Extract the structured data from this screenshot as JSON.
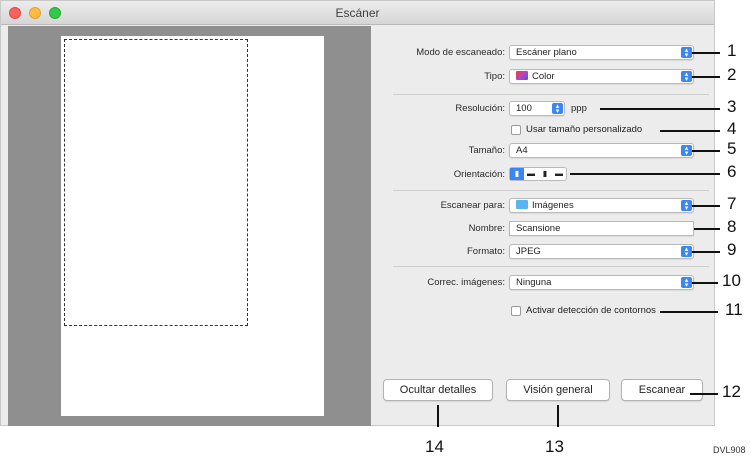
{
  "window": {
    "title": "Escáner"
  },
  "form": {
    "mode_label": "Modo de escaneado:",
    "mode_value": "Escáner plano",
    "type_label": "Tipo:",
    "type_value": "Color",
    "res_label": "Resolución:",
    "res_value": "100",
    "res_unit": "ppp",
    "custom_size_label": "Usar tamaño personalizado",
    "size_label": "Tamaño:",
    "size_value": "A4",
    "orient_label": "Orientación:",
    "scan_to_label": "Escanear para:",
    "scan_to_value": "Imágenes",
    "name_label": "Nombre:",
    "name_value": "Scansione",
    "format_label": "Formato:",
    "format_value": "JPEG",
    "correction_label": "Correc. imágenes:",
    "correction_value": "Ninguna",
    "edge_label": "Activar detección de contornos"
  },
  "buttons": {
    "hide_details": "Ocultar detalles",
    "overview": "Visión general",
    "scan": "Escanear"
  },
  "callouts": [
    "1",
    "2",
    "3",
    "4",
    "5",
    "6",
    "7",
    "8",
    "9",
    "10",
    "11",
    "12",
    "13",
    "14"
  ],
  "figure_code": "DVL908",
  "colors": {
    "accent": "#3a86f5",
    "close": "#fc605c",
    "minimize": "#fdbc40",
    "zoom": "#34c84a"
  }
}
